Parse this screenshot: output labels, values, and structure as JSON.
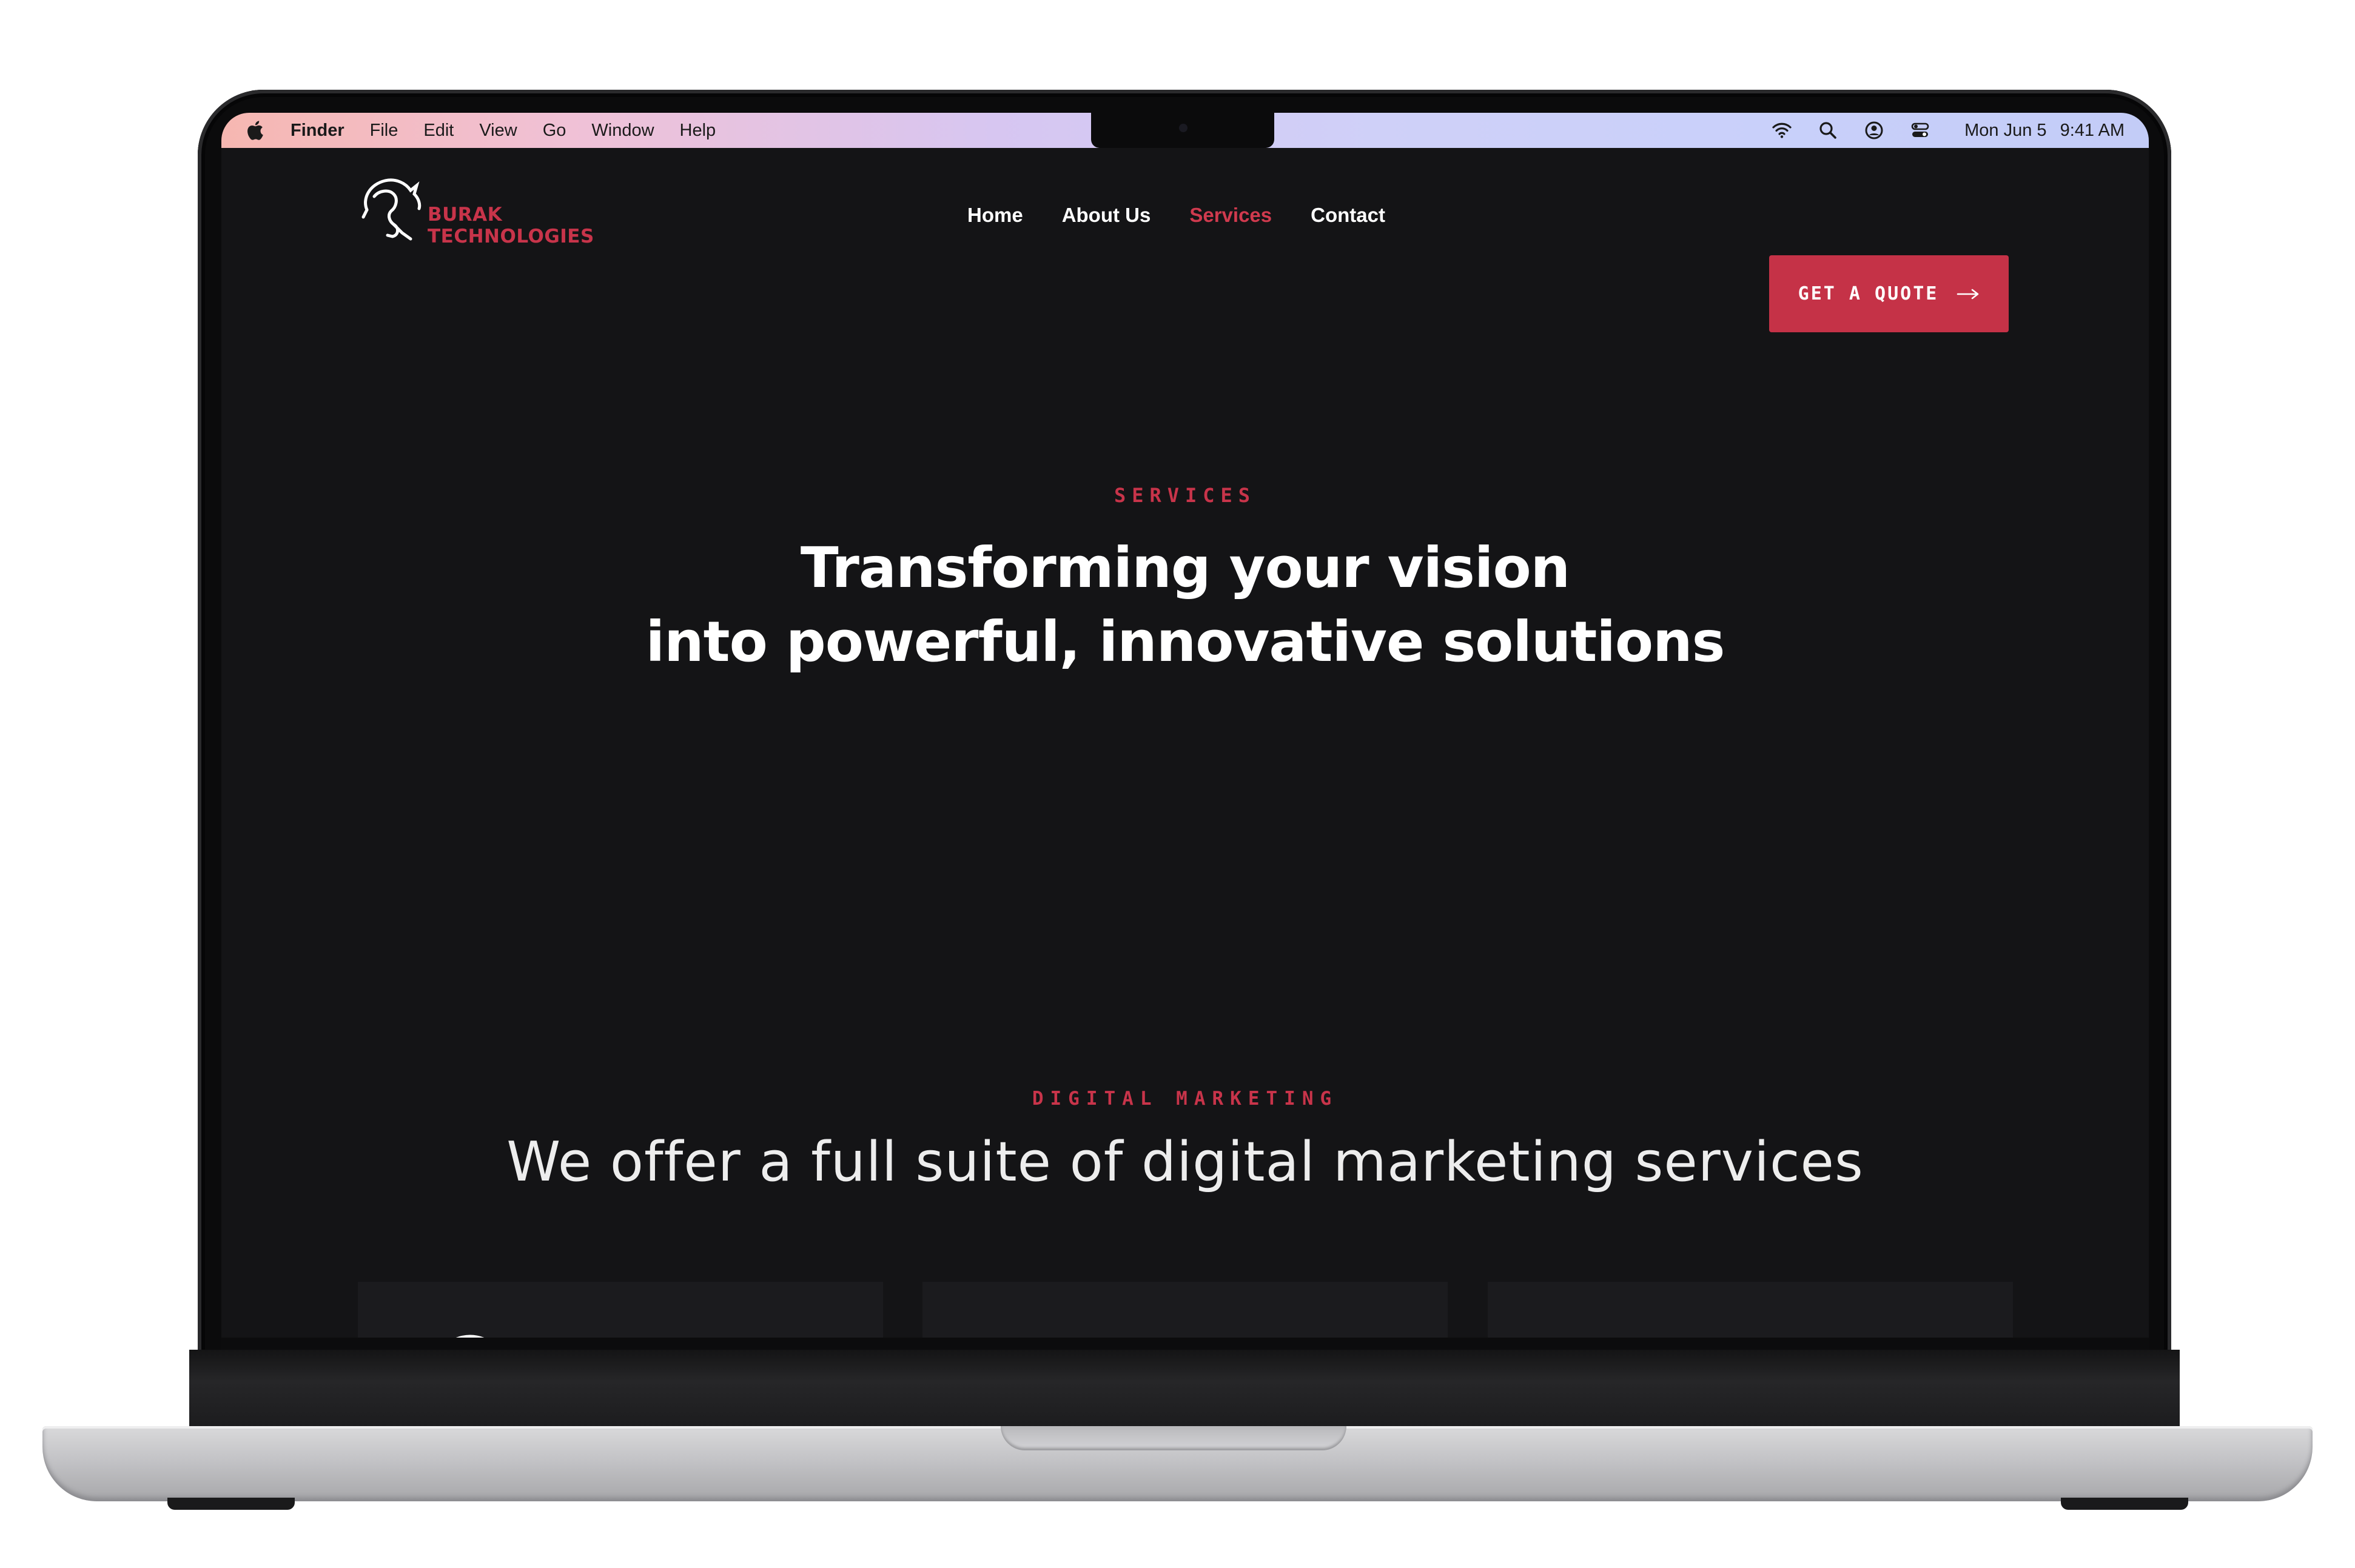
{
  "menubar": {
    "app_name": "Finder",
    "menus": [
      "File",
      "Edit",
      "View",
      "Go",
      "Window",
      "Help"
    ],
    "clock_date": "Mon Jun 5",
    "clock_time": "9:41 AM",
    "icons": [
      "apple-icon",
      "wifi-icon",
      "search-icon",
      "user-icon",
      "control-center-icon"
    ]
  },
  "site": {
    "logo": {
      "line1": "BURAK",
      "line2": "TECHNOLOGIES"
    },
    "nav": [
      "Home",
      "About Us",
      "Services",
      "Contact"
    ],
    "active_nav": "Services",
    "cta_label": "GET A QUOTE",
    "hero": {
      "eyebrow": "SERVICES",
      "title_line1": "Transforming your vision",
      "title_line2": "into powerful, innovative solutions"
    },
    "section": {
      "eyebrow": "DIGITAL MARKETING",
      "title": "We offer a full suite of digital marketing services"
    },
    "cards_icons": [
      "target-icon",
      "growth-icon",
      "social-icon"
    ]
  },
  "colors": {
    "accent": "#c53247",
    "background": "#141416",
    "text": "#ffffff"
  }
}
